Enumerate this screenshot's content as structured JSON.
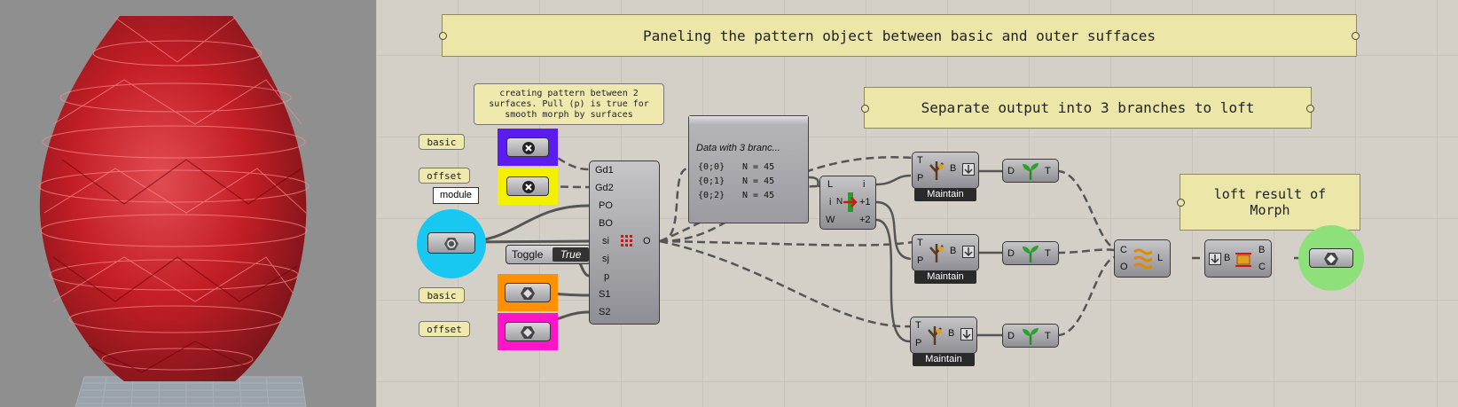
{
  "groups": {
    "top_title": "Paneling the pattern object between basic and outer suffaces",
    "separate_title": "Separate output into 3 branches to loft",
    "loft_title_line1": "loft result of",
    "loft_title_line2": "Morph"
  },
  "note_panel": {
    "line1": "creating pattern between 2",
    "line2": "surfaces. Pull (p) is true for",
    "line3": "smooth morph by surfaces"
  },
  "param_labels": {
    "basic_top": "basic",
    "offset_top": "offset",
    "module": "module",
    "basic_bottom": "basic",
    "offset_bottom": "offset"
  },
  "toggle": {
    "label": "Toggle",
    "value": "True"
  },
  "morph_component": {
    "inputs": [
      "Gd1",
      "Gd2",
      "PO",
      "BO",
      "si",
      "sj",
      "p",
      "S1",
      "S2"
    ],
    "output": "O"
  },
  "data_panel": {
    "title": "Data with 3 branc...",
    "rows": [
      {
        "path": "{0;0}",
        "count": "N = 45"
      },
      {
        "path": "{0;1}",
        "count": "N = 45"
      },
      {
        "path": "{0;2}",
        "count": "N = 45"
      }
    ]
  },
  "split_component": {
    "inputs": [
      "L",
      "i",
      "W"
    ],
    "outputs": [
      "i",
      "+1",
      "+2"
    ],
    "middle_symbol": "N"
  },
  "maintain_components": [
    {
      "inputs": [
        "T",
        "P"
      ],
      "output": "B",
      "tag": "Maintain"
    },
    {
      "inputs": [
        "T",
        "P"
      ],
      "output": "B",
      "tag": "Maintain"
    },
    {
      "inputs": [
        "T",
        "P"
      ],
      "output": "B",
      "tag": "Maintain"
    }
  ],
  "flatten_components": [
    {
      "input": "D",
      "output": "T"
    },
    {
      "input": "D",
      "output": "T"
    },
    {
      "input": "D",
      "output": "T"
    }
  ],
  "loft_component": {
    "inputs": [
      "C",
      "O"
    ],
    "output": "L"
  },
  "brep_component": {
    "input": "B",
    "outputs": [
      "B",
      "C"
    ]
  },
  "colors": {
    "canvas": "#d4d0c8",
    "viewport": "#8f8f8f",
    "vase": "#c8141c",
    "basic_param_bg": "#5b1cf0",
    "offset_param_bg": "#f5f000",
    "module_circle": "#19c8f0",
    "basic_surface_bg": "#ff9000",
    "offset_surface_bg": "#ff14c8",
    "output_circle": "#8ee07a"
  }
}
